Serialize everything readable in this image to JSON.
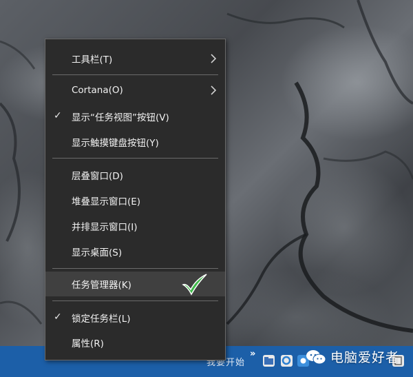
{
  "menu": {
    "items": [
      {
        "label": "工具栏(T)",
        "checked": false,
        "submenu": true
      },
      {
        "label": "Cortana(O)",
        "checked": false,
        "submenu": true
      },
      {
        "label": "显示“任务视图”按钮(V)",
        "checked": true,
        "submenu": false
      },
      {
        "label": "显示触摸键盘按钮(Y)",
        "checked": false,
        "submenu": false
      },
      {
        "label": "层叠窗口(D)",
        "checked": false,
        "submenu": false
      },
      {
        "label": "堆叠显示窗口(E)",
        "checked": false,
        "submenu": false
      },
      {
        "label": "并排显示窗口(I)",
        "checked": false,
        "submenu": false
      },
      {
        "label": "显示桌面(S)",
        "checked": false,
        "submenu": false
      },
      {
        "label": "任务管理器(K)",
        "checked": false,
        "submenu": false,
        "highlighted": true
      },
      {
        "label": "锁定任务栏(L)",
        "checked": true,
        "submenu": false
      },
      {
        "label": "属性(R)",
        "checked": false,
        "submenu": false
      }
    ]
  },
  "taskbar": {
    "search_text": "我要开始",
    "overflow_glyph": "»",
    "watermark": "电脑爱好者"
  },
  "colors": {
    "menu_bg": "#2b2b2b",
    "menu_highlight": "#404040",
    "taskbar_bg": "#1c5fa8",
    "annotation_check": "#3fb84a"
  },
  "glyphs": {
    "check": "✓"
  }
}
